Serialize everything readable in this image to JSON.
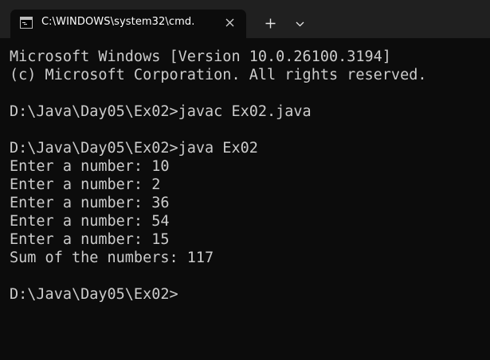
{
  "tab": {
    "title": "C:\\WINDOWS\\system32\\cmd.",
    "icon": "cmd-terminal-icon"
  },
  "controls": {
    "close_icon": "close-icon",
    "new_tab_icon": "plus-icon",
    "dropdown_icon": "chevron-down-icon"
  },
  "colors": {
    "background": "#0c0c0c",
    "titlebar": "#202020",
    "text": "#cccccc"
  },
  "terminal": {
    "lines": [
      "Microsoft Windows [Version 10.0.26100.3194]",
      "(c) Microsoft Corporation. All rights reserved.",
      "",
      "D:\\Java\\Day05\\Ex02>javac Ex02.java",
      "",
      "D:\\Java\\Day05\\Ex02>java Ex02",
      "Enter a number: 10",
      "Enter a number: 2",
      "Enter a number: 36",
      "Enter a number: 54",
      "Enter a number: 15",
      "Sum of the numbers: 117",
      "",
      "D:\\Java\\Day05\\Ex02>"
    ]
  }
}
